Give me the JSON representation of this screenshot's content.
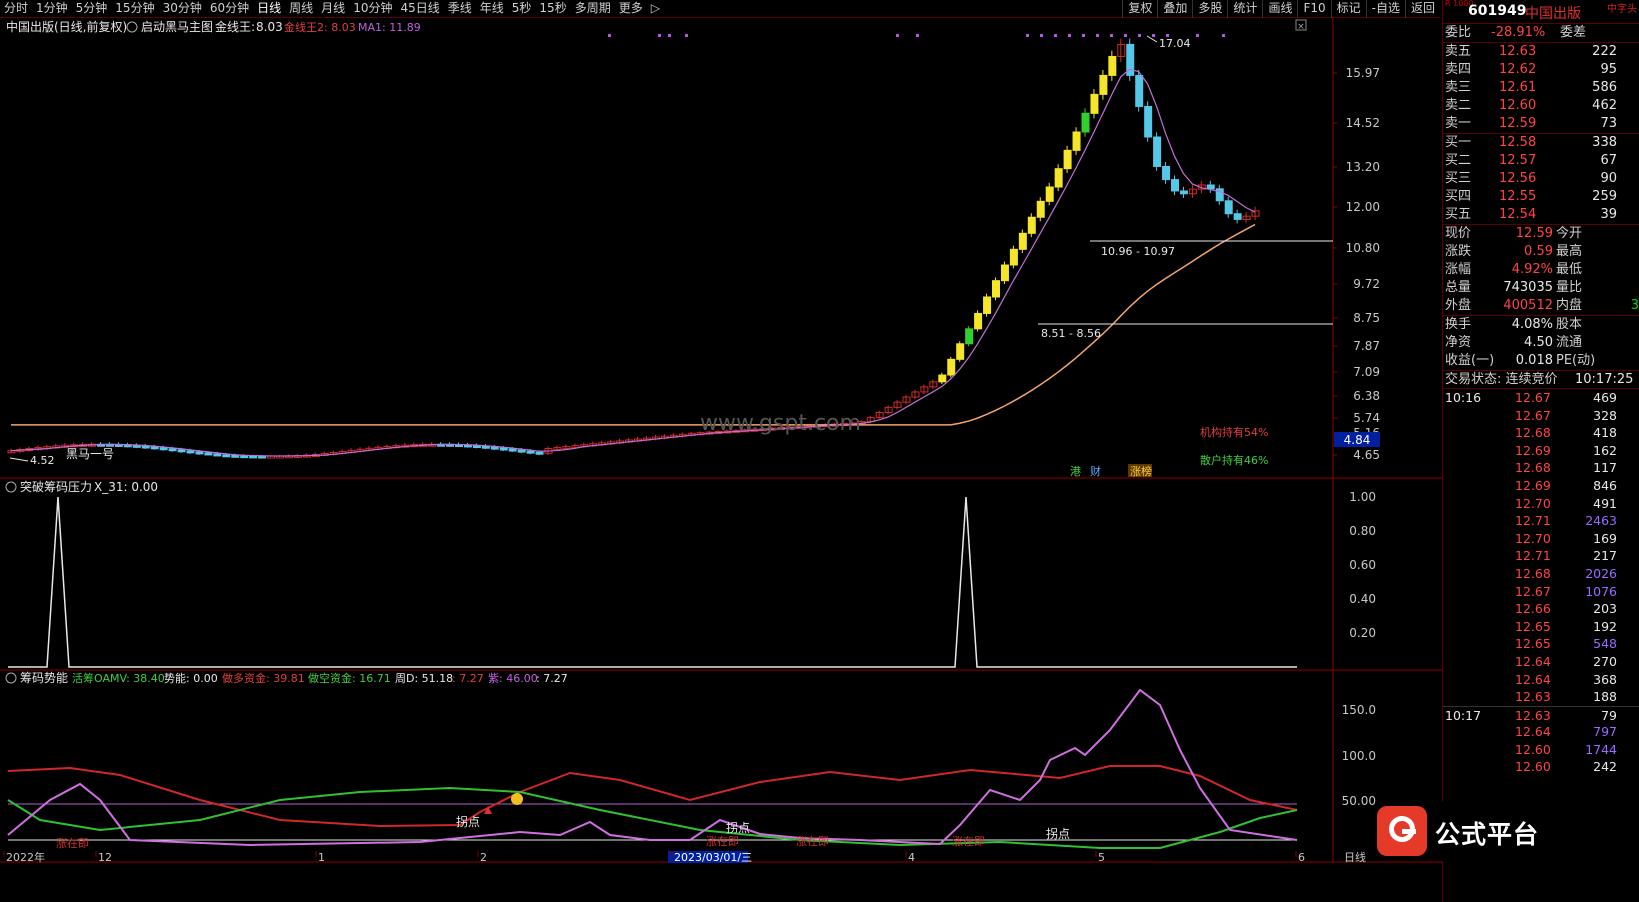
{
  "toolbar": {
    "periods": [
      "分时",
      "1分钟",
      "5分钟",
      "15分钟",
      "30分钟",
      "60分钟",
      "日线",
      "周线",
      "月线",
      "10分钟",
      "45日线",
      "季线",
      "年线",
      "5秒",
      "15秒",
      "多周期",
      "更多"
    ],
    "active_index": 6,
    "more_arrow": "▷",
    "buttons": [
      "复权",
      "叠加",
      "多股",
      "统计",
      "画线",
      "F10",
      "标记",
      "-自选",
      "返回"
    ]
  },
  "main_panel": {
    "title": "中国出版(日线,前复权)",
    "indicator": "启动黑马主图",
    "gold_label": "金线王:",
    "gold_value": "8.03",
    "gold2": "金线王2: 8.03",
    "ma1": "MA1: 11.89",
    "yaxis": [
      "15.97",
      "14.52",
      "13.20",
      "12.00",
      "10.80",
      "9.72",
      "8.75",
      "7.87",
      "7.09",
      "6.38",
      "5.74",
      "5.16",
      "4.65"
    ],
    "cur_price_tag": "4.84",
    "peak": "17.04",
    "low_mark": "4.52",
    "range1": "10.96 - 10.97",
    "range2": "8.51 - 8.56",
    "inst": "机构持有54%",
    "retail": "散户持有46%",
    "tag_gang": "港",
    "tag_cai": "财",
    "tag_zhang": "涨榜",
    "dark_horse": "黑马一号",
    "watermark": "www.gspt.com"
  },
  "mid_panel": {
    "title": "突破筹码压力",
    "val": "X_31: 0.00",
    "yaxis": [
      "1.00",
      "0.80",
      "0.60",
      "0.40",
      "0.20"
    ]
  },
  "bottom_panel": {
    "title": "筹码势能",
    "huo": "活筹OAMV: 38.40",
    "shi": "势能: 0.00",
    "duo": "做多资金: 39.81",
    "kong": "做空资金: 16.71",
    "zhou": "周D: 51.18",
    "v1": ": 7.27",
    "zi": "紫: 46.00",
    "v2": ": 7.27",
    "yaxis": [
      "150.0",
      "100.0",
      "50.00"
    ],
    "guaidian": "拐点",
    "zhangting": "涨在即"
  },
  "xaxis": {
    "labels": [
      "2022年",
      "12",
      "1",
      "2",
      "2023/03/01/三",
      "4",
      "5",
      "6"
    ],
    "period": "日线"
  },
  "quote": {
    "code": "601949",
    "name": "中国出版",
    "extra": "中字头",
    "r": "R 1000",
    "weibi_label": "委比",
    "weibi": "-28.91%",
    "weicha": "委差",
    "asks": [
      {
        "l": "卖五",
        "p": "12.63",
        "v": "222"
      },
      {
        "l": "卖四",
        "p": "12.62",
        "v": "95"
      },
      {
        "l": "卖三",
        "p": "12.61",
        "v": "586"
      },
      {
        "l": "卖二",
        "p": "12.60",
        "v": "462"
      },
      {
        "l": "卖一",
        "p": "12.59",
        "v": "73"
      }
    ],
    "bids": [
      {
        "l": "买一",
        "p": "12.58",
        "v": "338"
      },
      {
        "l": "买二",
        "p": "12.57",
        "v": "67"
      },
      {
        "l": "买三",
        "p": "12.56",
        "v": "90"
      },
      {
        "l": "买四",
        "p": "12.55",
        "v": "259"
      },
      {
        "l": "买五",
        "p": "12.54",
        "v": "39"
      }
    ],
    "stats1": [
      {
        "a": "现价",
        "b": "12.59",
        "c": "今开"
      },
      {
        "a": "涨跌",
        "b": "0.59",
        "c": "最高"
      },
      {
        "a": "涨幅",
        "b": "4.92%",
        "c": "最低"
      },
      {
        "a": "总量",
        "b": "743035",
        "c": "量比"
      },
      {
        "a": "外盘",
        "b": "400512",
        "c": "内盘",
        "d": "3"
      }
    ],
    "stats2": [
      {
        "a": "换手",
        "b": "4.08%",
        "c": "股本"
      },
      {
        "a": "净资",
        "b": "4.50",
        "c": "流通"
      },
      {
        "a": "收益(一)",
        "b": "0.018",
        "c": "PE(动)"
      }
    ],
    "status_label": "交易状态: 连续竞价",
    "status_time": "10:17:25",
    "ticks": [
      {
        "t": "10:16",
        "p": "12.67",
        "v": "469",
        "c": "w"
      },
      {
        "t": "",
        "p": "12.67",
        "v": "328",
        "c": "w"
      },
      {
        "t": "",
        "p": "12.68",
        "v": "418",
        "c": "w"
      },
      {
        "t": "",
        "p": "12.69",
        "v": "162",
        "c": "w"
      },
      {
        "t": "",
        "p": "12.68",
        "v": "117",
        "c": "w"
      },
      {
        "t": "",
        "p": "12.69",
        "v": "846",
        "c": "w"
      },
      {
        "t": "",
        "p": "12.70",
        "v": "491",
        "c": "w"
      },
      {
        "t": "",
        "p": "12.71",
        "v": "2463",
        "c": "p"
      },
      {
        "t": "",
        "p": "12.70",
        "v": "169",
        "c": "w"
      },
      {
        "t": "",
        "p": "12.71",
        "v": "217",
        "c": "w"
      },
      {
        "t": "",
        "p": "12.68",
        "v": "2026",
        "c": "p"
      },
      {
        "t": "",
        "p": "12.67",
        "v": "1076",
        "c": "p"
      },
      {
        "t": "",
        "p": "12.66",
        "v": "203",
        "c": "w"
      },
      {
        "t": "",
        "p": "12.65",
        "v": "192",
        "c": "w"
      },
      {
        "t": "",
        "p": "12.65",
        "v": "548",
        "c": "p"
      },
      {
        "t": "",
        "p": "12.64",
        "v": "270",
        "c": "w"
      },
      {
        "t": "",
        "p": "12.64",
        "v": "368",
        "c": "w"
      },
      {
        "t": "",
        "p": "12.63",
        "v": "188",
        "c": "w"
      },
      {
        "t": "10:17",
        "p": "12.63",
        "v": "79",
        "c": "w"
      },
      {
        "t": "",
        "p": "12.64",
        "v": "797",
        "c": "p"
      },
      {
        "t": "",
        "p": "12.60",
        "v": "1744",
        "c": "p"
      },
      {
        "t": "",
        "p": "12.60",
        "v": "242",
        "c": "w"
      }
    ]
  },
  "logo_text": "公式平台"
}
